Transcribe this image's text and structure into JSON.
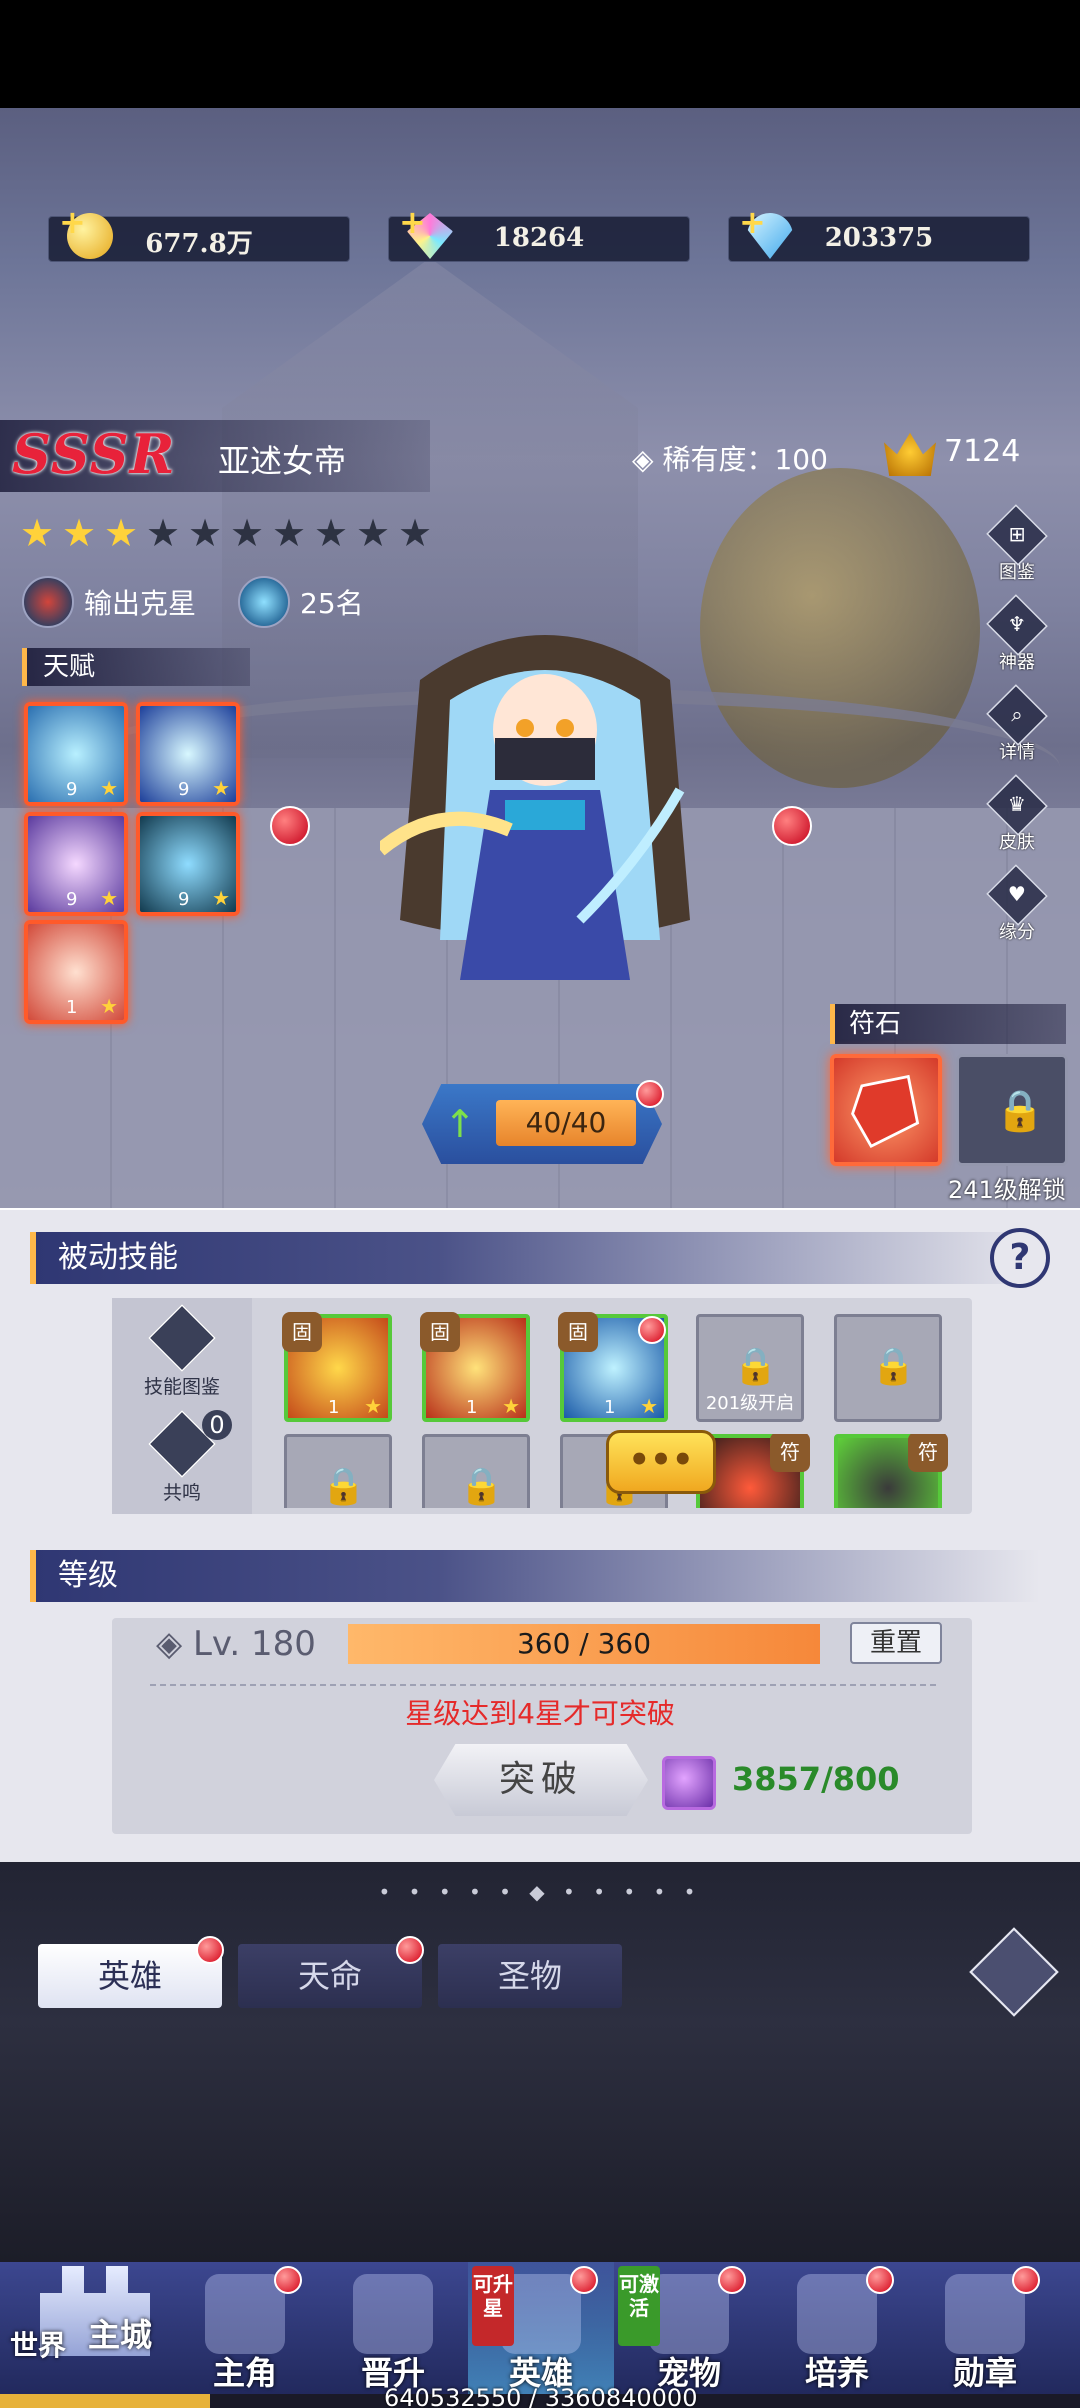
{
  "currencies": [
    {
      "value": "677.8万",
      "icon": "gold-coin-icon"
    },
    {
      "value": "18264",
      "icon": "rainbow-gem-icon"
    },
    {
      "value": "203375",
      "icon": "blue-diamond-icon"
    }
  ],
  "hero": {
    "grade": "SSSR",
    "name": "亚述女帝",
    "rarity": "稀有度：100",
    "power": "7124",
    "stars_total": 10,
    "stars_lit": 3,
    "role": "输出克星",
    "rank": "25名"
  },
  "talent": {
    "title": "天赋",
    "items": [
      {
        "num": "9"
      },
      {
        "num": "9"
      },
      {
        "num": "9"
      },
      {
        "num": "9"
      },
      {
        "num": "1"
      }
    ]
  },
  "side_menu": [
    "图鉴",
    "神器",
    "详情",
    "皮肤",
    "缘分"
  ],
  "level_badge": "40/40",
  "rune": {
    "title": "符石",
    "unlock": "241级解锁"
  },
  "passive": {
    "title": "被动技能",
    "help": "?",
    "tool1": "技能图鉴",
    "tool2": "共鸣",
    "tool2_count": "0",
    "fix_tag": "固",
    "fu_tag": "符",
    "skill_num": "1",
    "locked_unlock": "201级开启"
  },
  "level": {
    "title": "等级",
    "label": "Lv. 180",
    "exp": "360 / 360",
    "reset": "重置",
    "warning": "星级达到4星才可突破",
    "break_btn": "突破",
    "cost": "3857/800"
  },
  "divider": "• • • • • ◆ • • • • •",
  "tabs": [
    {
      "label": "英雄",
      "selected": true
    },
    {
      "label": "天命",
      "selected": false
    },
    {
      "label": "圣物",
      "selected": false
    }
  ],
  "nav": {
    "main_city": "主城",
    "world": "世界",
    "items": [
      {
        "label": "主角"
      },
      {
        "label": "晋升"
      },
      {
        "label": "英雄",
        "active": true
      },
      {
        "label": "宠物"
      },
      {
        "label": "培养"
      },
      {
        "label": "勋章"
      }
    ],
    "tag_upstar": "可升星",
    "tag_activate": "可激活"
  },
  "exp_bar": "640532550 / 3360840000",
  "colors": {
    "accent": "#ffb84a",
    "danger": "#e52a2a",
    "ok": "#2a8a2a",
    "nav": "#2c3578"
  }
}
